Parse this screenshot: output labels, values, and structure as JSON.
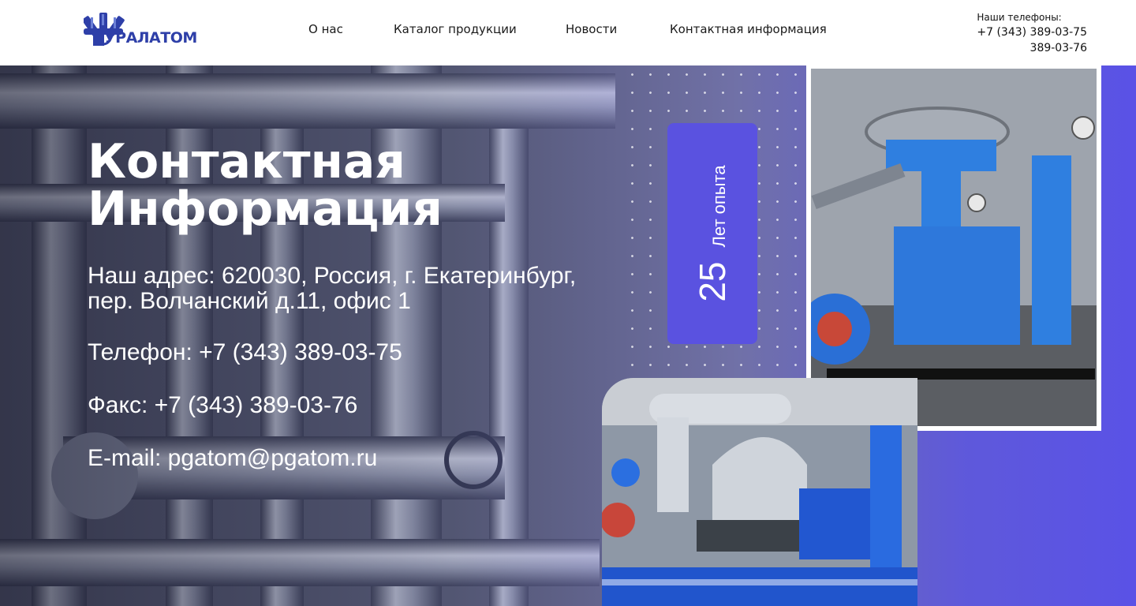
{
  "brand": {
    "logo_text": "УРАЛАТОМ",
    "accent": "#5a52e0",
    "logo_color": "#2e3fa8"
  },
  "nav": {
    "items": [
      {
        "label": "О нас"
      },
      {
        "label": "Каталог продукции"
      },
      {
        "label": "Новости"
      },
      {
        "label": "Контактная информация"
      }
    ]
  },
  "phones": {
    "label": "Наши телефоны:",
    "numbers": [
      "+7 (343) 389-03-75",
      "389-03-76"
    ]
  },
  "hero": {
    "title_line1": "Контактная",
    "title_line2": "Информация",
    "address_line1": "Наш адрес: 620030, Россия, г. Екатеринбург,",
    "address_line2": "пер. Волчанский д.11, офис 1",
    "phone": "Телефон: +7 (343) 389-03-75",
    "fax": "Факс: +7 (343) 389-03-76",
    "email": "E-mail: pgatom@pgatom.ru"
  },
  "badge": {
    "number": "25",
    "text": "Лет опыта"
  }
}
